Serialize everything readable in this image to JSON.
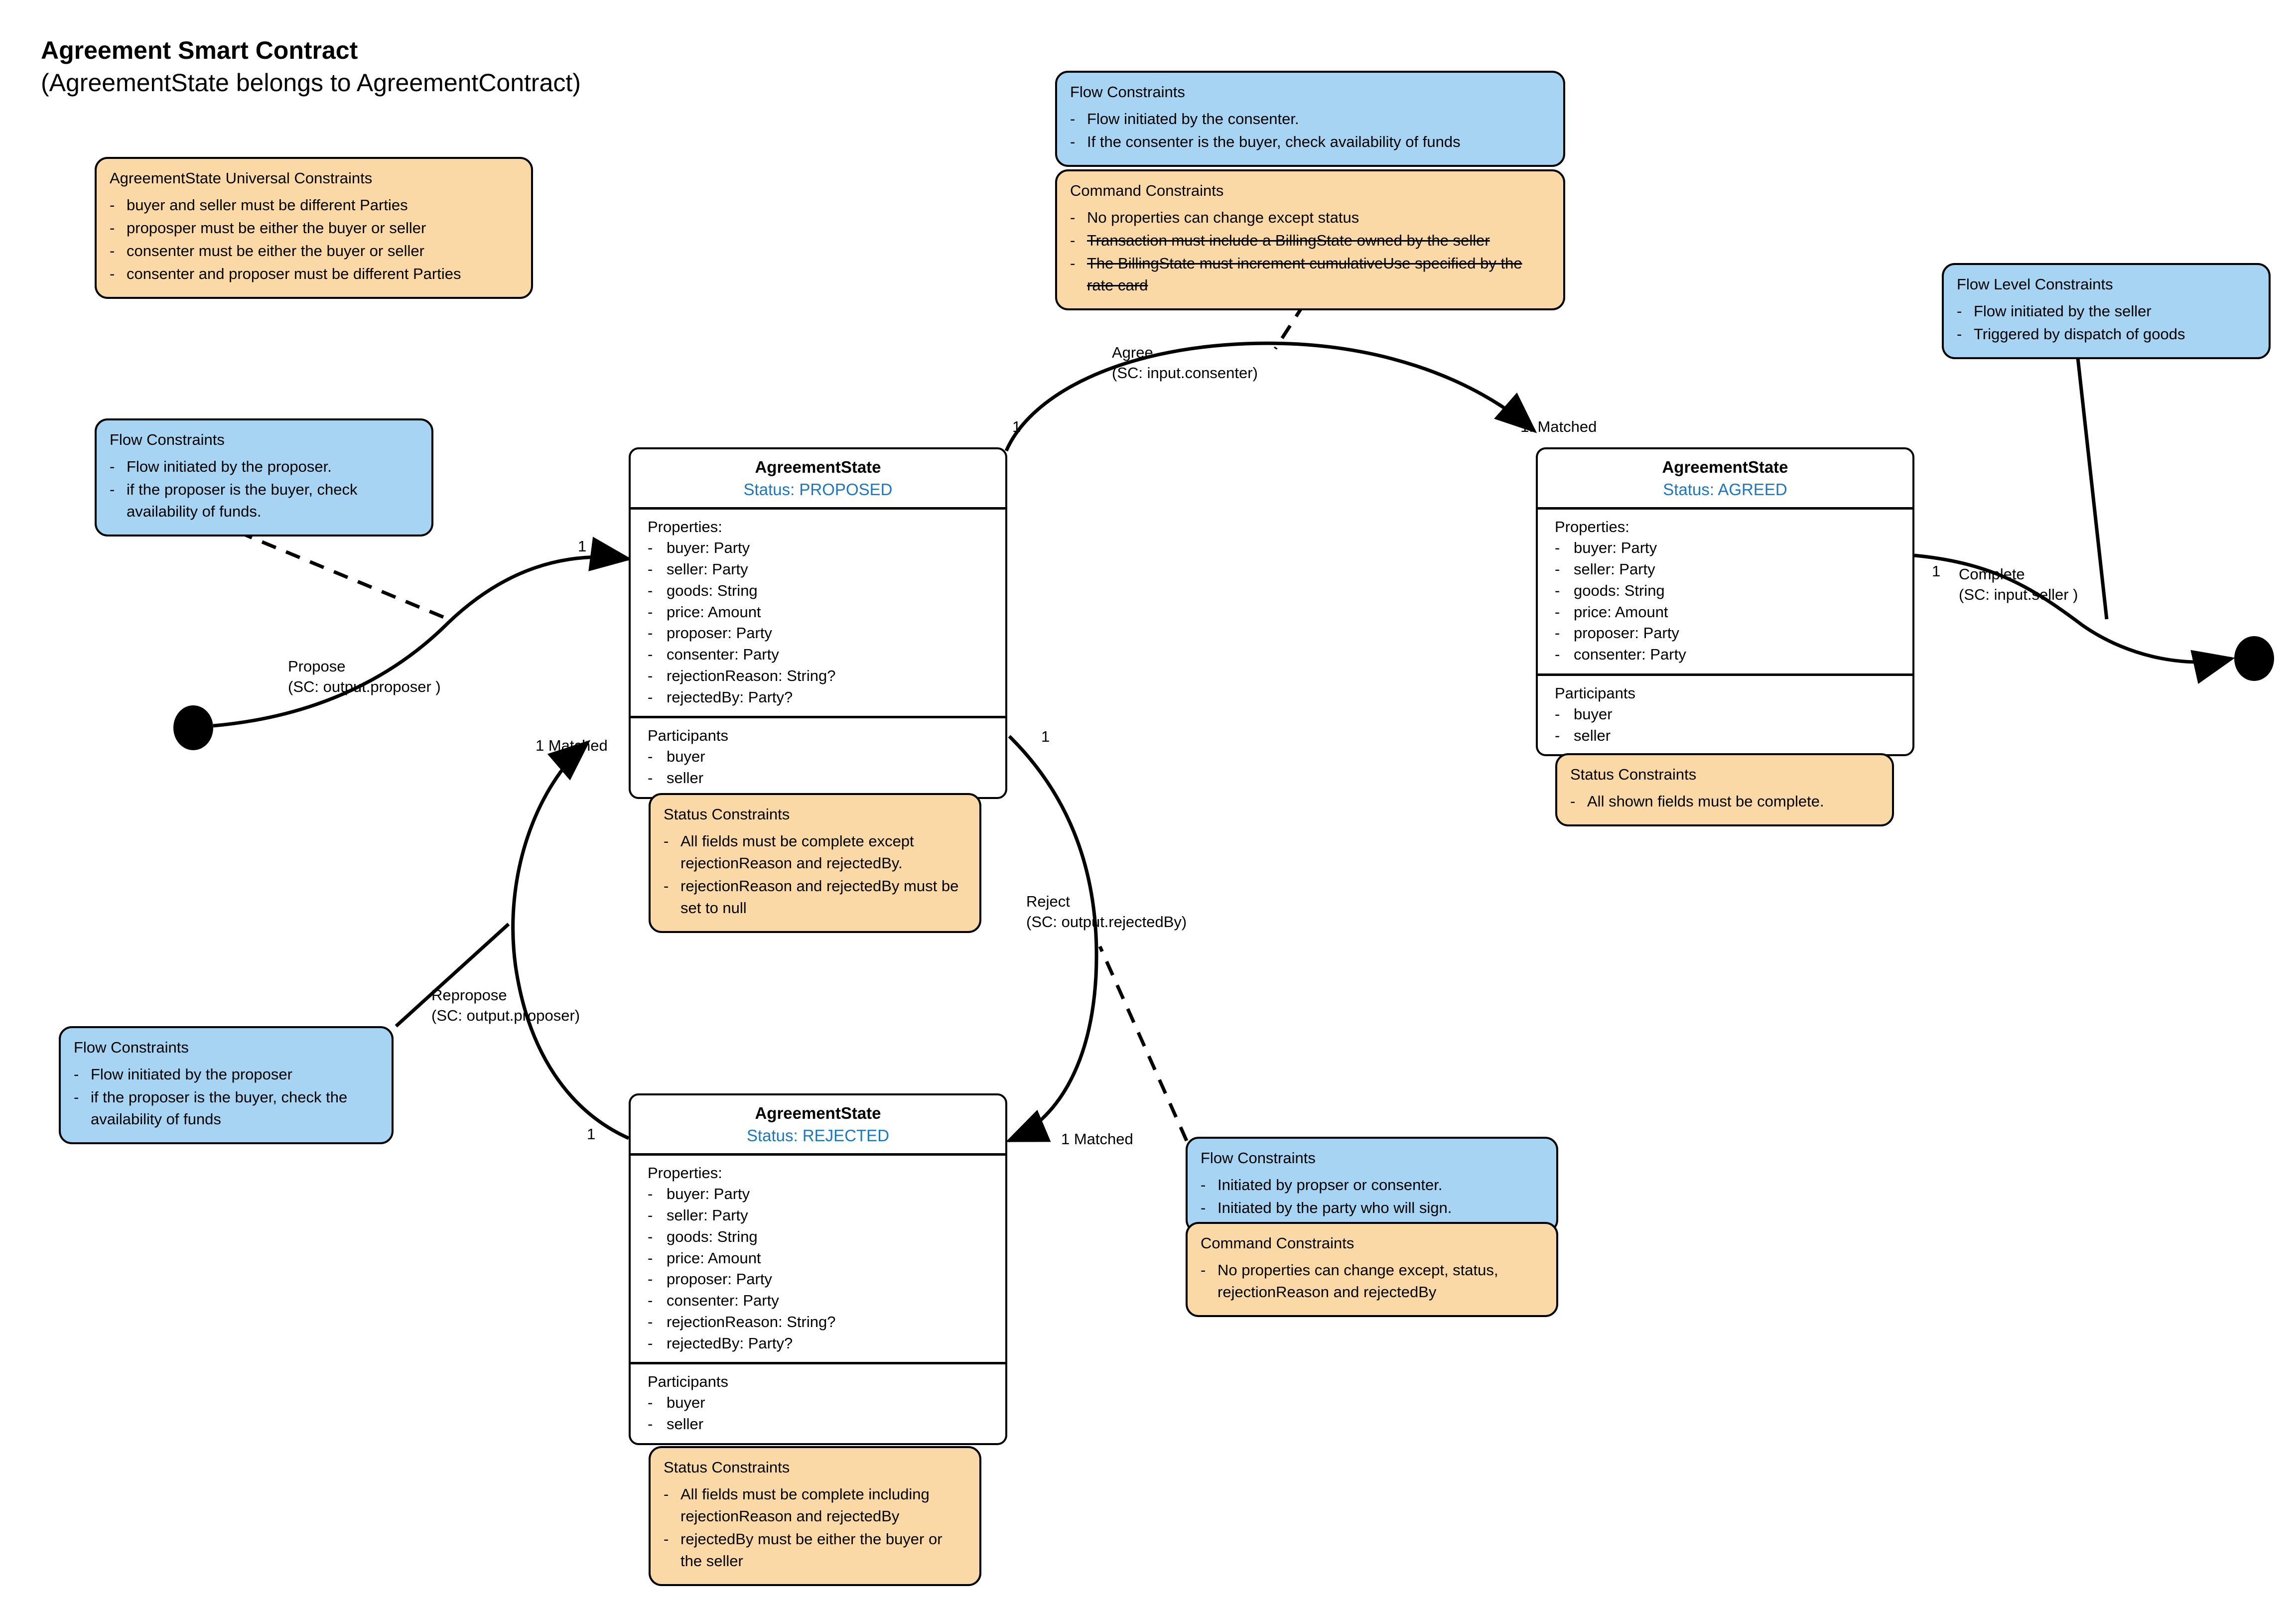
{
  "title": {
    "heading": "Agreement Smart Contract",
    "subheading": "(AgreementState belongs to AgreementContract)"
  },
  "colors": {
    "note_blue": "#a6d4f2",
    "note_orange": "#fbd9a6",
    "status_text": "#1b78be",
    "stroke": "#000000"
  },
  "notes": {
    "universal_constraints": {
      "title": "AgreementState Universal Constraints",
      "items": [
        "buyer and seller must be different Parties",
        "proposper must be either the buyer or seller",
        "consenter must be either the buyer or seller",
        "consenter and proposer must be different Parties"
      ]
    },
    "propose_flow": {
      "title": "Flow Constraints",
      "items": [
        "Flow initiated by the proposer.",
        "if the proposer is the buyer, check availability of funds."
      ]
    },
    "repropose_flow": {
      "title": "Flow Constraints",
      "items": [
        "Flow initiated by the proposer",
        "if the proposer is the buyer, check the availability of funds"
      ]
    },
    "agree_flow": {
      "title": "Flow Constraints",
      "items": [
        "Flow initiated by the consenter.",
        "If the consenter is the buyer, check availability of funds"
      ]
    },
    "agree_command": {
      "title": "Command Constraints",
      "items": [
        {
          "text": "No properties can change except status",
          "struck": false
        },
        {
          "text": "Transaction must include a BillingState owned by the seller",
          "struck": true
        },
        {
          "text": "The BillingState must increment cumulativeUse specified by the rate card",
          "struck": true
        }
      ]
    },
    "reject_flow": {
      "title": "Flow Constraints",
      "items": [
        "Initiated by propser or consenter.",
        "Initiated by the party who will sign."
      ]
    },
    "reject_command": {
      "title": "Command Constraints",
      "items": [
        "No properties can change except, status, rejectionReason and rejectedBy"
      ]
    },
    "complete_flow": {
      "title": "Flow Level Constraints",
      "items": [
        "Flow initiated by the seller",
        "Triggered by dispatch of goods"
      ]
    },
    "proposed_status": {
      "title": "Status Constraints",
      "items": [
        "All fields must be complete except rejectionReason and rejectedBy.",
        "rejectionReason and rejectedBy must be set to null"
      ]
    },
    "agreed_status": {
      "title": "Status Constraints",
      "items": [
        "All shown fields must be complete."
      ]
    },
    "rejected_status": {
      "title": "Status Constraints",
      "items": [
        "All fields must be complete including rejectionReason and rejectedBy",
        "rejectedBy must be either the buyer or the seller"
      ]
    }
  },
  "states": {
    "proposed": {
      "name": "AgreementState",
      "status": "Status: PROPOSED",
      "properties_label": "Properties:",
      "properties": [
        "buyer: Party",
        "seller: Party",
        "goods: String",
        "price: Amount",
        "proposer: Party",
        "consenter: Party",
        "rejectionReason: String?",
        "rejectedBy: Party?"
      ],
      "participants_label": "Participants",
      "participants": [
        "buyer",
        "seller"
      ]
    },
    "agreed": {
      "name": "AgreementState",
      "status": "Status: AGREED",
      "properties_label": "Properties:",
      "properties": [
        "buyer: Party",
        "seller: Party",
        "goods: String",
        "price: Amount",
        "proposer: Party",
        "consenter: Party"
      ],
      "participants_label": "Participants",
      "participants": [
        "buyer",
        "seller"
      ]
    },
    "rejected": {
      "name": "AgreementState",
      "status": "Status: REJECTED",
      "properties_label": "Properties:",
      "properties": [
        "buyer: Party",
        "seller: Party",
        "goods: String",
        "price: Amount",
        "proposer: Party",
        "consenter: Party",
        "rejectionReason: String?",
        "rejectedBy: Party?"
      ],
      "participants_label": "Participants",
      "participants": [
        "buyer",
        "seller"
      ]
    }
  },
  "transitions": {
    "propose": {
      "name": "Propose",
      "signer": "(SC: output.proposer )"
    },
    "agree": {
      "name": "Agree",
      "signer": "(SC: input.consenter)"
    },
    "complete": {
      "name": "Complete",
      "signer": "(SC: input.seller )"
    },
    "reject": {
      "name": "Reject",
      "signer": "(SC: output.rejectedBy)"
    },
    "repropose": {
      "name": "Repropose",
      "signer": "(SC: output.proposer)"
    }
  },
  "multiplicities": {
    "propose_in": "1",
    "agree_out": "1",
    "agree_in": "1: Matched",
    "complete_out": "1",
    "reject_out": "1",
    "reject_in": "1 Matched",
    "repropose_out": "1",
    "repropose_in": "1 Matched"
  }
}
